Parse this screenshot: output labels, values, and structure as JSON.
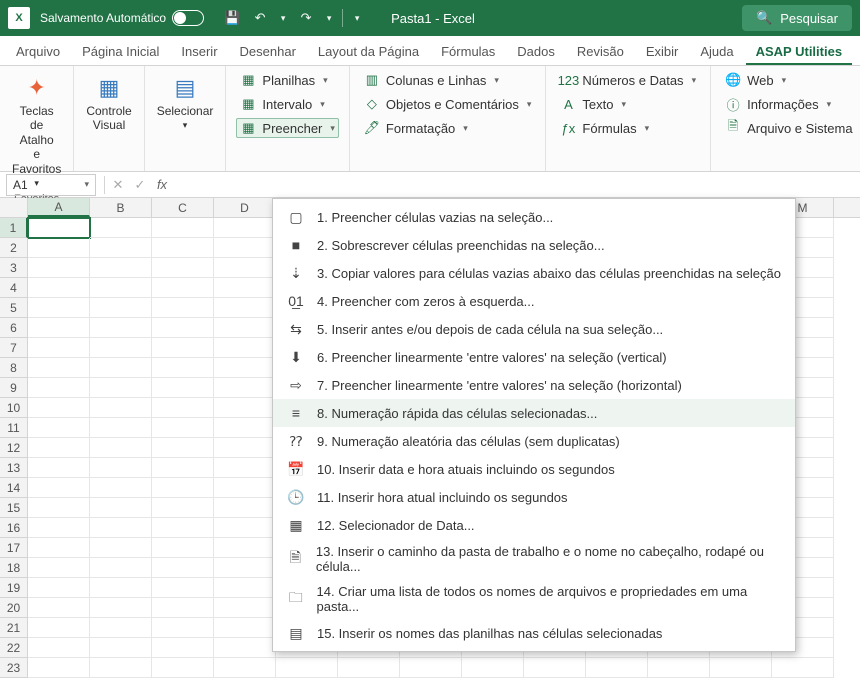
{
  "titlebar": {
    "autosave": "Salvamento Automático",
    "doc_title": "Pasta1  -  Excel",
    "search_label": "Pesquisar"
  },
  "tabs": [
    "Arquivo",
    "Página Inicial",
    "Inserir",
    "Desenhar",
    "Layout da Página",
    "Fórmulas",
    "Dados",
    "Revisão",
    "Exibir",
    "Ajuda",
    "ASAP Utilities"
  ],
  "active_tab": 10,
  "ribbon": {
    "group1_label": "Favoritos",
    "big1_label": "Teclas de Atalho\ne Favoritos",
    "big2_label": "Controle\nVisual",
    "big3_label": "Selecionar",
    "col1": [
      "Planilhas",
      "Intervalo",
      "Preencher"
    ],
    "col2": [
      "Colunas e Linhas",
      "Objetos e Comentários",
      "Formatação"
    ],
    "col3": [
      "Números e Datas",
      "Texto",
      "Fórmulas"
    ],
    "col4": [
      "Web",
      "Informações",
      "Arquivo e Sistema"
    ]
  },
  "name_box": "A1",
  "columns": [
    "A",
    "B",
    "C",
    "D",
    "",
    "",
    "",
    "",
    "",
    "",
    "",
    "",
    "M"
  ],
  "dropdown": {
    "highlight_index": 7,
    "items": [
      {
        "n": "1.",
        "label": "Preencher células vazias na seleção..."
      },
      {
        "n": "2.",
        "label": "Sobrescrever células preenchidas na seleção..."
      },
      {
        "n": "3.",
        "label": "Copiar valores para células vazias abaixo das células preenchidas na seleção"
      },
      {
        "n": "4.",
        "label": "Preencher com zeros à esquerda..."
      },
      {
        "n": "5.",
        "label": "Inserir antes e/ou depois de cada célula na sua seleção..."
      },
      {
        "n": "6.",
        "label": "Preencher linearmente 'entre valores' na seleção (vertical)"
      },
      {
        "n": "7.",
        "label": "Preencher linearmente 'entre valores' na seleção (horizontal)"
      },
      {
        "n": "8.",
        "label": "Numeração rápida das células selecionadas..."
      },
      {
        "n": "9.",
        "label": "Numeração aleatória das células (sem duplicatas)"
      },
      {
        "n": "10.",
        "label": "Inserir data e hora atuais incluindo os segundos"
      },
      {
        "n": "11.",
        "label": "Inserir hora atual incluindo os segundos"
      },
      {
        "n": "12.",
        "label": "Selecionador de Data..."
      },
      {
        "n": "13.",
        "label": "Inserir o caminho da pasta de trabalho e o nome no cabeçalho, rodapé ou célula..."
      },
      {
        "n": "14.",
        "label": "Criar uma lista de todos os nomes de arquivos e propriedades em uma pasta..."
      },
      {
        "n": "15.",
        "label": "Inserir os nomes das planilhas nas células selecionadas"
      }
    ]
  }
}
